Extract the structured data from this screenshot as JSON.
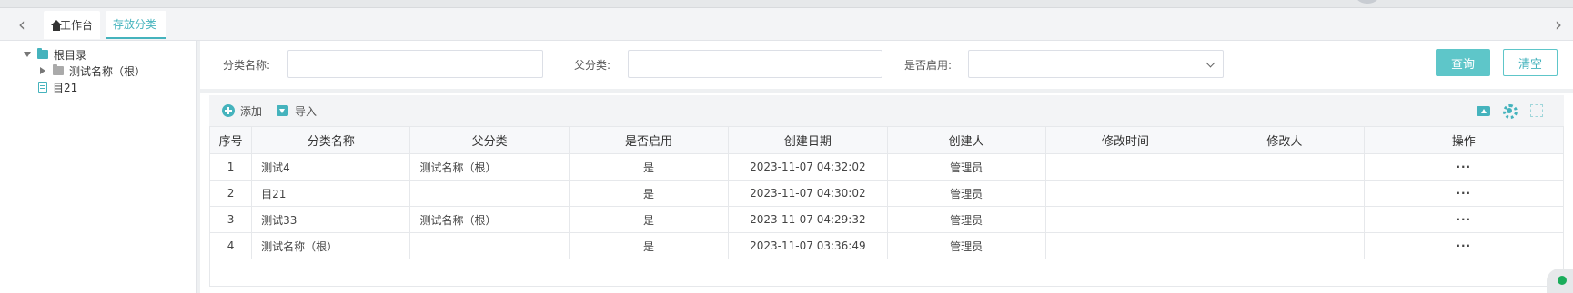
{
  "tabs": {
    "home_label": "工作台",
    "active_label": "存放分类"
  },
  "tree": {
    "root_label": "根目录",
    "child_label": "测试名称（根）",
    "sibling_label": "目21"
  },
  "search": {
    "name_label": "分类名称:",
    "parent_label": "父分类:",
    "enabled_label": "是否启用:",
    "name_value": "",
    "parent_value": "",
    "enabled_value": "",
    "query_button": "查询",
    "clear_button": "清空"
  },
  "toolbar": {
    "add_label": "添加",
    "import_label": "导入"
  },
  "table": {
    "headers": [
      "序号",
      "分类名称",
      "父分类",
      "是否启用",
      "创建日期",
      "创建人",
      "修改时间",
      "修改人",
      "操作"
    ],
    "rows": [
      {
        "index": "1",
        "name": "测试4",
        "parent": "测试名称（根）",
        "enabled": "是",
        "created": "2023-11-07 04:32:02",
        "creator": "管理员",
        "modified": "",
        "modifier": "",
        "action": "···"
      },
      {
        "index": "2",
        "name": "目21",
        "parent": "",
        "enabled": "是",
        "created": "2023-11-07 04:30:02",
        "creator": "管理员",
        "modified": "",
        "modifier": "",
        "action": "···"
      },
      {
        "index": "3",
        "name": "测试33",
        "parent": "测试名称（根）",
        "enabled": "是",
        "created": "2023-11-07 04:29:32",
        "creator": "管理员",
        "modified": "",
        "modifier": "",
        "action": "···"
      },
      {
        "index": "4",
        "name": "测试名称（根）",
        "parent": "",
        "enabled": "是",
        "created": "2023-11-07 03:36:49",
        "creator": "管理员",
        "modified": "",
        "modifier": "",
        "action": "···"
      }
    ]
  },
  "colors": {
    "accent": "#45b3bd",
    "primary_button": "#5ec6c9",
    "status_online": "#1aad5b"
  }
}
